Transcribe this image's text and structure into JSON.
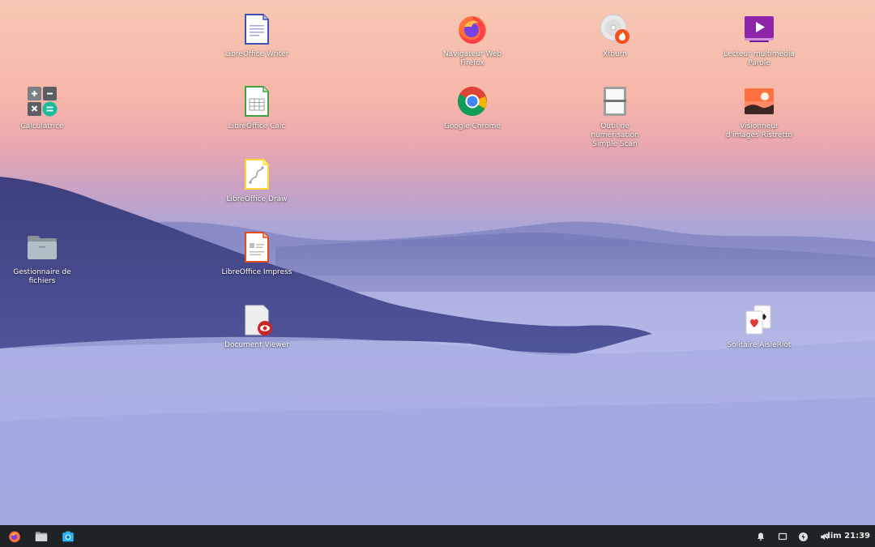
{
  "desktop_icons": [
    {
      "id": "writer",
      "label": "LibreOffice Writer",
      "icon": "libreoffice-writer-icon"
    },
    {
      "id": "firefox",
      "label": "Navigateur Web Firefox",
      "icon": "firefox-icon"
    },
    {
      "id": "xfburn",
      "label": "Xfburn",
      "icon": "xfburn-disc-icon"
    },
    {
      "id": "parole",
      "label": "Lecteur multimédia Parole",
      "icon": "parole-media-player-icon"
    },
    {
      "id": "calc_app",
      "label": "Calculatrice",
      "icon": "calculator-icon"
    },
    {
      "id": "calc",
      "label": "LibreOffice Calc",
      "icon": "libreoffice-calc-icon"
    },
    {
      "id": "chrome",
      "label": "Google Chrome",
      "icon": "chrome-icon"
    },
    {
      "id": "scan",
      "label": "Outil de numérisation Simple Scan",
      "icon": "simple-scan-icon"
    },
    {
      "id": "ristretto",
      "label": "Visionneur d'images Ristretto",
      "icon": "image-viewer-icon"
    },
    {
      "id": "draw",
      "label": "LibreOffice Draw",
      "icon": "libreoffice-draw-icon"
    },
    {
      "id": "files",
      "label": "Gestionnaire de fichiers",
      "icon": "folder-icon"
    },
    {
      "id": "impress",
      "label": "LibreOffice Impress",
      "icon": "libreoffice-impress-icon"
    },
    {
      "id": "docviewer",
      "label": "Document Viewer",
      "icon": "document-viewer-icon"
    },
    {
      "id": "solitaire",
      "label": "Solitaire AisleRiot",
      "icon": "solitaire-cards-icon"
    }
  ],
  "taskbar": {
    "left": [
      {
        "name": "firefox-launcher",
        "icon": "firefox-icon"
      },
      {
        "name": "files-launcher",
        "icon": "folder-icon"
      },
      {
        "name": "screenshot-launcher",
        "icon": "camera-icon"
      }
    ],
    "tray": [
      {
        "name": "notifications",
        "icon": "bell-icon"
      },
      {
        "name": "display",
        "icon": "display-icon"
      },
      {
        "name": "power",
        "icon": "power-icon"
      },
      {
        "name": "volume",
        "icon": "volume-icon"
      }
    ],
    "clock": "dim 21:39"
  },
  "colors": {
    "taskbar_bg": "#1f2326",
    "label_text": "#ffffff"
  }
}
